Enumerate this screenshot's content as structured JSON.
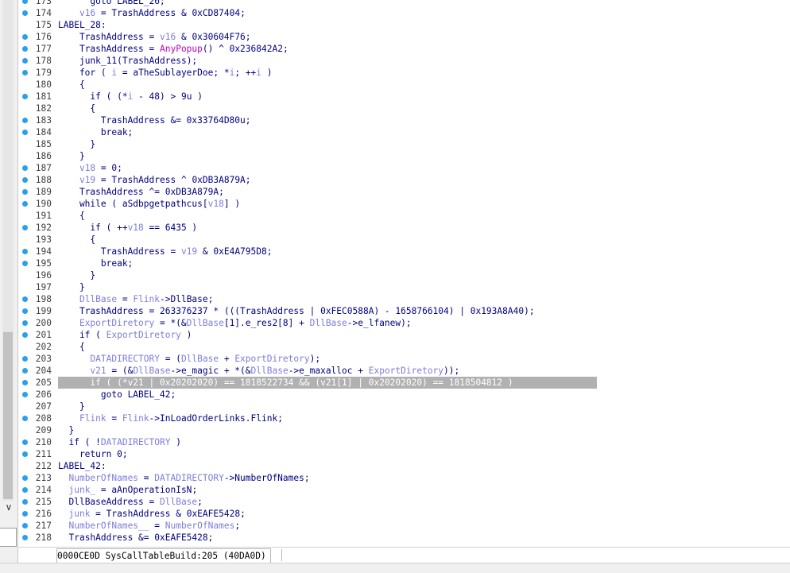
{
  "status_bar": {
    "offset": "0000CE0D",
    "location": "SysCallTableBuild:205 (40DA0D)"
  },
  "code_lines": [
    {
      "num": "173",
      "dot": true,
      "tokens": [
        [
          "      goto ",
          "t-kw"
        ],
        [
          "LABEL_26",
          "t-lbl"
        ],
        [
          ";",
          "t-op"
        ]
      ]
    },
    {
      "num": "174",
      "dot": true,
      "tokens": [
        [
          "    ",
          "t-op"
        ],
        [
          "v16",
          "t-lvar"
        ],
        [
          " = ",
          "t-op"
        ],
        [
          "TrashAddress",
          "t-global"
        ],
        [
          " & ",
          "t-op"
        ],
        [
          "0xCD87404",
          "t-num"
        ],
        [
          ";",
          "t-op"
        ]
      ]
    },
    {
      "num": "175",
      "dot": false,
      "tokens": [
        [
          "LABEL_28",
          "t-lbl"
        ],
        [
          ":",
          "t-op"
        ]
      ]
    },
    {
      "num": "176",
      "dot": true,
      "tokens": [
        [
          "    ",
          "t-op"
        ],
        [
          "TrashAddress",
          "t-global"
        ],
        [
          " = ",
          "t-op"
        ],
        [
          "v16",
          "t-lvar"
        ],
        [
          " & ",
          "t-op"
        ],
        [
          "0x30604F76",
          "t-num"
        ],
        [
          ";",
          "t-op"
        ]
      ]
    },
    {
      "num": "177",
      "dot": true,
      "tokens": [
        [
          "    ",
          "t-op"
        ],
        [
          "TrashAddress",
          "t-global"
        ],
        [
          " = ",
          "t-op"
        ],
        [
          "AnyPopup",
          "t-func"
        ],
        [
          "() ^ ",
          "t-op"
        ],
        [
          "0x236842A2",
          "t-num"
        ],
        [
          ";",
          "t-op"
        ]
      ]
    },
    {
      "num": "178",
      "dot": true,
      "tokens": [
        [
          "    ",
          "t-op"
        ],
        [
          "junk_11",
          "t-fn"
        ],
        [
          "(",
          "t-op"
        ],
        [
          "TrashAddress",
          "t-global"
        ],
        [
          ");",
          "t-op"
        ]
      ]
    },
    {
      "num": "179",
      "dot": true,
      "tokens": [
        [
          "    for ( ",
          "t-kw"
        ],
        [
          "i",
          "t-lvar"
        ],
        [
          " = ",
          "t-op"
        ],
        [
          "aTheSublayerDoe",
          "t-global"
        ],
        [
          "; *",
          "t-op"
        ],
        [
          "i",
          "t-lvar"
        ],
        [
          "; ++",
          "t-op"
        ],
        [
          "i",
          "t-lvar"
        ],
        [
          " )",
          "t-op"
        ]
      ]
    },
    {
      "num": "180",
      "dot": false,
      "tokens": [
        [
          "    {",
          "t-op"
        ]
      ]
    },
    {
      "num": "181",
      "dot": true,
      "tokens": [
        [
          "      if ( (*",
          "t-kw"
        ],
        [
          "i",
          "t-lvar"
        ],
        [
          " - ",
          "t-op"
        ],
        [
          "48",
          "t-num"
        ],
        [
          ") > ",
          "t-op"
        ],
        [
          "9u",
          "t-num"
        ],
        [
          " )",
          "t-op"
        ]
      ]
    },
    {
      "num": "182",
      "dot": false,
      "tokens": [
        [
          "      {",
          "t-op"
        ]
      ]
    },
    {
      "num": "183",
      "dot": true,
      "tokens": [
        [
          "        ",
          "t-op"
        ],
        [
          "TrashAddress",
          "t-global"
        ],
        [
          " &= ",
          "t-op"
        ],
        [
          "0x33764D80u",
          "t-num"
        ],
        [
          ";",
          "t-op"
        ]
      ]
    },
    {
      "num": "184",
      "dot": true,
      "tokens": [
        [
          "        break;",
          "t-kw"
        ]
      ]
    },
    {
      "num": "185",
      "dot": false,
      "tokens": [
        [
          "      }",
          "t-op"
        ]
      ]
    },
    {
      "num": "186",
      "dot": false,
      "tokens": [
        [
          "    }",
          "t-op"
        ]
      ]
    },
    {
      "num": "187",
      "dot": true,
      "tokens": [
        [
          "    ",
          "t-op"
        ],
        [
          "v18",
          "t-lvar"
        ],
        [
          " = ",
          "t-op"
        ],
        [
          "0",
          "t-num"
        ],
        [
          ";",
          "t-op"
        ]
      ]
    },
    {
      "num": "188",
      "dot": true,
      "tokens": [
        [
          "    ",
          "t-op"
        ],
        [
          "v19",
          "t-lvar"
        ],
        [
          " = ",
          "t-op"
        ],
        [
          "TrashAddress",
          "t-global"
        ],
        [
          " ^ ",
          "t-op"
        ],
        [
          "0xDB3A879A",
          "t-num"
        ],
        [
          ";",
          "t-op"
        ]
      ]
    },
    {
      "num": "189",
      "dot": true,
      "tokens": [
        [
          "    ",
          "t-op"
        ],
        [
          "TrashAddress",
          "t-global"
        ],
        [
          " ^= ",
          "t-op"
        ],
        [
          "0xDB3A879A",
          "t-num"
        ],
        [
          ";",
          "t-op"
        ]
      ]
    },
    {
      "num": "190",
      "dot": true,
      "tokens": [
        [
          "    while ( ",
          "t-kw"
        ],
        [
          "aSdbpgetpathcus",
          "t-global"
        ],
        [
          "[",
          "t-op"
        ],
        [
          "v18",
          "t-lvar"
        ],
        [
          "] )",
          "t-op"
        ]
      ]
    },
    {
      "num": "191",
      "dot": false,
      "tokens": [
        [
          "    {",
          "t-op"
        ]
      ]
    },
    {
      "num": "192",
      "dot": true,
      "tokens": [
        [
          "      if ( ++",
          "t-kw"
        ],
        [
          "v18",
          "t-lvar"
        ],
        [
          " == ",
          "t-op"
        ],
        [
          "6435",
          "t-num"
        ],
        [
          " )",
          "t-op"
        ]
      ]
    },
    {
      "num": "193",
      "dot": false,
      "tokens": [
        [
          "      {",
          "t-op"
        ]
      ]
    },
    {
      "num": "194",
      "dot": true,
      "tokens": [
        [
          "        ",
          "t-op"
        ],
        [
          "TrashAddress",
          "t-global"
        ],
        [
          " = ",
          "t-op"
        ],
        [
          "v19",
          "t-lvar"
        ],
        [
          " & ",
          "t-op"
        ],
        [
          "0xE4A795D8",
          "t-num"
        ],
        [
          ";",
          "t-op"
        ]
      ]
    },
    {
      "num": "195",
      "dot": true,
      "tokens": [
        [
          "        break;",
          "t-kw"
        ]
      ]
    },
    {
      "num": "196",
      "dot": false,
      "tokens": [
        [
          "      }",
          "t-op"
        ]
      ]
    },
    {
      "num": "197",
      "dot": false,
      "tokens": [
        [
          "    }",
          "t-op"
        ]
      ]
    },
    {
      "num": "198",
      "dot": true,
      "tokens": [
        [
          "    ",
          "t-op"
        ],
        [
          "DllBase",
          "t-lvar"
        ],
        [
          " = ",
          "t-op"
        ],
        [
          "Flink",
          "t-lvar"
        ],
        [
          "->DllBase;",
          "t-op"
        ]
      ]
    },
    {
      "num": "199",
      "dot": true,
      "tokens": [
        [
          "    ",
          "t-op"
        ],
        [
          "TrashAddress",
          "t-global"
        ],
        [
          " = ",
          "t-op"
        ],
        [
          "263376237",
          "t-num"
        ],
        [
          " * (((",
          "t-op"
        ],
        [
          "TrashAddress",
          "t-global"
        ],
        [
          " | ",
          "t-op"
        ],
        [
          "0xFEC0588A",
          "t-num"
        ],
        [
          ") - ",
          "t-op"
        ],
        [
          "1658766104",
          "t-num"
        ],
        [
          ") | ",
          "t-op"
        ],
        [
          "0x193A8A40",
          "t-num"
        ],
        [
          ");",
          "t-op"
        ]
      ]
    },
    {
      "num": "200",
      "dot": true,
      "tokens": [
        [
          "    ",
          "t-op"
        ],
        [
          "ExportDiretory",
          "t-lvar"
        ],
        [
          " = *(&",
          "t-op"
        ],
        [
          "DllBase",
          "t-lvar"
        ],
        [
          "[1].e_res2[8] + ",
          "t-op"
        ],
        [
          "DllBase",
          "t-lvar"
        ],
        [
          "->e_lfanew);",
          "t-op"
        ]
      ]
    },
    {
      "num": "201",
      "dot": true,
      "tokens": [
        [
          "    if ( ",
          "t-kw"
        ],
        [
          "ExportDiretory",
          "t-lvar"
        ],
        [
          " )",
          "t-op"
        ]
      ]
    },
    {
      "num": "202",
      "dot": false,
      "tokens": [
        [
          "    {",
          "t-op"
        ]
      ]
    },
    {
      "num": "203",
      "dot": true,
      "tokens": [
        [
          "      ",
          "t-op"
        ],
        [
          "DATADIRECTORY",
          "t-lvar"
        ],
        [
          " = (",
          "t-op"
        ],
        [
          "DllBase",
          "t-lvar"
        ],
        [
          " + ",
          "t-op"
        ],
        [
          "ExportDiretory",
          "t-lvar"
        ],
        [
          ");",
          "t-op"
        ]
      ]
    },
    {
      "num": "204",
      "dot": true,
      "tokens": [
        [
          "      ",
          "t-op"
        ],
        [
          "v21",
          "t-lvar"
        ],
        [
          " = (&",
          "t-op"
        ],
        [
          "DllBase",
          "t-lvar"
        ],
        [
          "->e_magic + *(&",
          "t-op"
        ],
        [
          "DllBase",
          "t-lvar"
        ],
        [
          "->e_maxalloc + ",
          "t-op"
        ],
        [
          "ExportDiretory",
          "t-lvar"
        ],
        [
          "));",
          "t-op"
        ]
      ]
    },
    {
      "num": "205",
      "dot": true,
      "highlight": true,
      "tokens": [
        [
          "      if ( (*",
          "t-kw"
        ],
        [
          "v21",
          "t-lvar"
        ],
        [
          " | ",
          "t-op"
        ],
        [
          "0x20202020",
          "t-num"
        ],
        [
          ") == ",
          "t-op"
        ],
        [
          "1818522734",
          "t-num"
        ],
        [
          " && (",
          "t-op"
        ],
        [
          "v21",
          "t-lvar"
        ],
        [
          "[1] | ",
          "t-op"
        ],
        [
          "0x20202020",
          "t-num"
        ],
        [
          ") == ",
          "t-op"
        ],
        [
          "1818504812",
          "t-num"
        ],
        [
          " )",
          "t-op"
        ]
      ]
    },
    {
      "num": "206",
      "dot": true,
      "tokens": [
        [
          "        goto ",
          "t-kw"
        ],
        [
          "LABEL_42",
          "t-lbl"
        ],
        [
          ";",
          "t-op"
        ]
      ]
    },
    {
      "num": "207",
      "dot": false,
      "tokens": [
        [
          "    }",
          "t-op"
        ]
      ]
    },
    {
      "num": "208",
      "dot": true,
      "tokens": [
        [
          "    ",
          "t-op"
        ],
        [
          "Flink",
          "t-lvar"
        ],
        [
          " = ",
          "t-op"
        ],
        [
          "Flink",
          "t-lvar"
        ],
        [
          "->InLoadOrderLinks.Flink;",
          "t-op"
        ]
      ]
    },
    {
      "num": "209",
      "dot": false,
      "tokens": [
        [
          "  }",
          "t-op"
        ]
      ]
    },
    {
      "num": "210",
      "dot": true,
      "tokens": [
        [
          "  if ( !",
          "t-kw"
        ],
        [
          "DATADIRECTORY",
          "t-lvar"
        ],
        [
          " )",
          "t-op"
        ]
      ]
    },
    {
      "num": "211",
      "dot": true,
      "tokens": [
        [
          "    return ",
          "t-kw"
        ],
        [
          "0",
          "t-num"
        ],
        [
          ";",
          "t-op"
        ]
      ]
    },
    {
      "num": "212",
      "dot": false,
      "tokens": [
        [
          "LABEL_42",
          "t-lbl"
        ],
        [
          ":",
          "t-op"
        ]
      ]
    },
    {
      "num": "213",
      "dot": true,
      "tokens": [
        [
          "  ",
          "t-op"
        ],
        [
          "NumberOfNames",
          "t-lvar"
        ],
        [
          " = ",
          "t-op"
        ],
        [
          "DATADIRECTORY",
          "t-lvar"
        ],
        [
          "->NumberOfNames;",
          "t-op"
        ]
      ]
    },
    {
      "num": "214",
      "dot": true,
      "tokens": [
        [
          "  ",
          "t-op"
        ],
        [
          "junk_",
          "t-lvar"
        ],
        [
          " = ",
          "t-op"
        ],
        [
          "aAnOperationIsN",
          "t-global"
        ],
        [
          ";",
          "t-op"
        ]
      ]
    },
    {
      "num": "215",
      "dot": true,
      "tokens": [
        [
          "  ",
          "t-op"
        ],
        [
          "DllBaseAddress",
          "t-global"
        ],
        [
          " = ",
          "t-op"
        ],
        [
          "DllBase",
          "t-lvar"
        ],
        [
          ";",
          "t-op"
        ]
      ]
    },
    {
      "num": "216",
      "dot": true,
      "tokens": [
        [
          "  ",
          "t-op"
        ],
        [
          "junk",
          "t-lvar"
        ],
        [
          " = ",
          "t-op"
        ],
        [
          "TrashAddress",
          "t-global"
        ],
        [
          " & ",
          "t-op"
        ],
        [
          "0xEAFE5428",
          "t-num"
        ],
        [
          ";",
          "t-op"
        ]
      ]
    },
    {
      "num": "217",
      "dot": true,
      "tokens": [
        [
          "  ",
          "t-op"
        ],
        [
          "NumberOfNames__",
          "t-lvar"
        ],
        [
          " = ",
          "t-op"
        ],
        [
          "NumberOfNames",
          "t-lvar"
        ],
        [
          ";",
          "t-op"
        ]
      ]
    },
    {
      "num": "218",
      "dot": true,
      "tokens": [
        [
          "  ",
          "t-op"
        ],
        [
          "TrashAddress",
          "t-global"
        ],
        [
          " &= ",
          "t-op"
        ],
        [
          "0xEAFE5428",
          "t-num"
        ],
        [
          ";",
          "t-op"
        ]
      ]
    }
  ]
}
